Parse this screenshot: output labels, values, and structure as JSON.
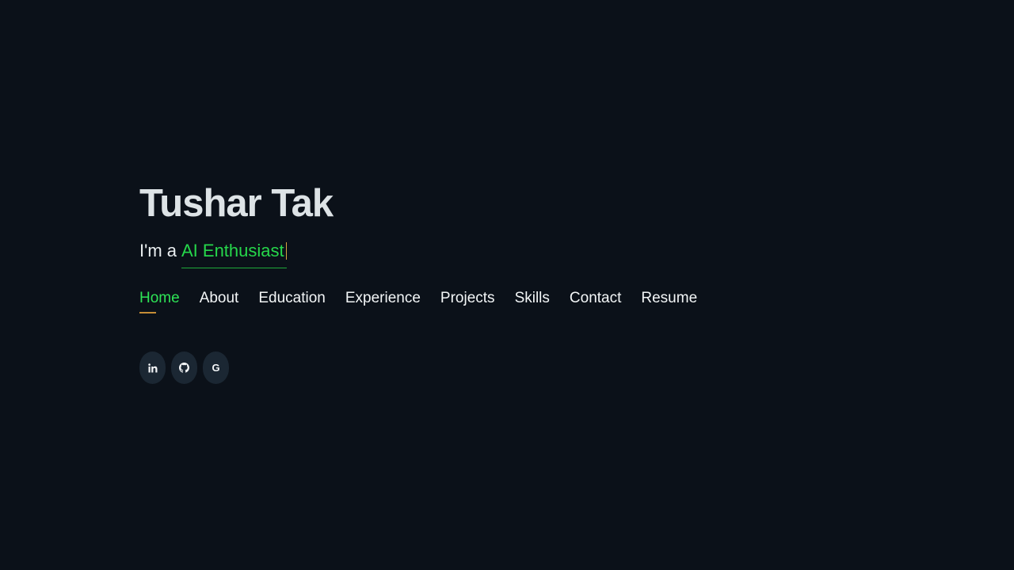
{
  "hero": {
    "name": "Tushar Tak",
    "tagline_prefix": "I'm a",
    "typed_role": "AI Enthusiast"
  },
  "nav": {
    "items": [
      {
        "label": "Home",
        "active": true
      },
      {
        "label": "About",
        "active": false
      },
      {
        "label": "Education",
        "active": false
      },
      {
        "label": "Experience",
        "active": false
      },
      {
        "label": "Projects",
        "active": false
      },
      {
        "label": "Skills",
        "active": false
      },
      {
        "label": "Contact",
        "active": false
      },
      {
        "label": "Resume",
        "active": false
      }
    ]
  },
  "socials": [
    {
      "icon": "linkedin-icon"
    },
    {
      "icon": "github-icon"
    },
    {
      "icon": "google-icon",
      "glyph": "G"
    }
  ],
  "colors": {
    "background": "#0b1119",
    "accent_green": "#26d74b",
    "nav_active": "#2ee456",
    "underline_orange": "#c58d36",
    "text": "#f3f6f7",
    "social_bg": "#1b2733"
  }
}
